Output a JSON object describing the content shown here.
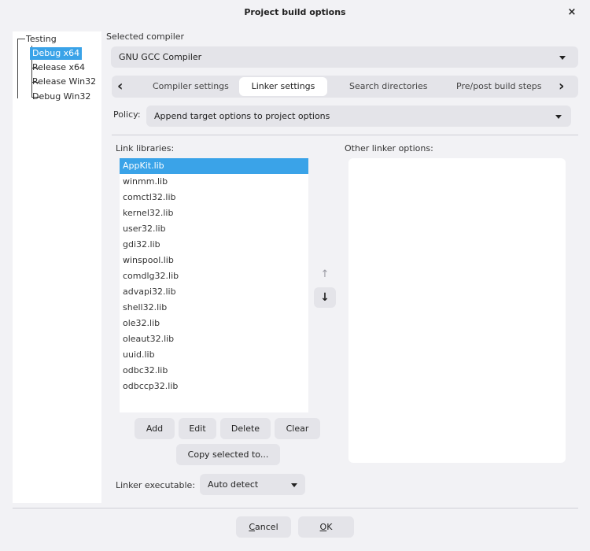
{
  "window": {
    "title": "Project build options",
    "close_symbol": "×"
  },
  "tree": {
    "root": "Testing",
    "items": [
      {
        "label": "Debug x64",
        "selected": true
      },
      {
        "label": "Release x64",
        "selected": false
      },
      {
        "label": "Release Win32",
        "selected": false
      },
      {
        "label": "Debug Win32",
        "selected": false
      }
    ]
  },
  "compiler": {
    "label": "Selected compiler",
    "value": "GNU GCC Compiler"
  },
  "tabs": {
    "items": [
      {
        "label": "Compiler settings",
        "active": false
      },
      {
        "label": "Linker settings",
        "active": true
      },
      {
        "label": "Search directories",
        "active": false
      },
      {
        "label": "Pre/post build steps",
        "active": false
      }
    ],
    "prev_symbol": "‹",
    "next_symbol": "›"
  },
  "policy": {
    "label": "Policy:",
    "value": "Append target options to project options"
  },
  "link_libraries": {
    "label": "Link libraries:",
    "items": [
      "AppKit.lib",
      "winmm.lib",
      "comctl32.lib",
      "kernel32.lib",
      "user32.lib",
      "gdi32.lib",
      "winspool.lib",
      "comdlg32.lib",
      "advapi32.lib",
      "shell32.lib",
      "ole32.lib",
      "oleaut32.lib",
      "uuid.lib",
      "odbc32.lib",
      "odbccp32.lib"
    ],
    "selected_index": 0,
    "move_up_symbol": "↑",
    "move_down_symbol": "↓"
  },
  "other_linker_options": {
    "label": "Other linker options:",
    "value": ""
  },
  "buttons": {
    "add": "Add",
    "edit": "Edit",
    "delete": "Delete",
    "clear": "Clear",
    "copy_selected": "Copy selected to..."
  },
  "linker_executable": {
    "label": "Linker executable:",
    "value": "Auto detect"
  },
  "footer": {
    "cancel": {
      "mnemonic": "C",
      "rest": "ancel"
    },
    "ok": {
      "mnemonic": "O",
      "rest": "K"
    }
  },
  "colors": {
    "accent": "#3aa3e8",
    "background": "#f2f2f5",
    "control": "#e4e4e9"
  }
}
